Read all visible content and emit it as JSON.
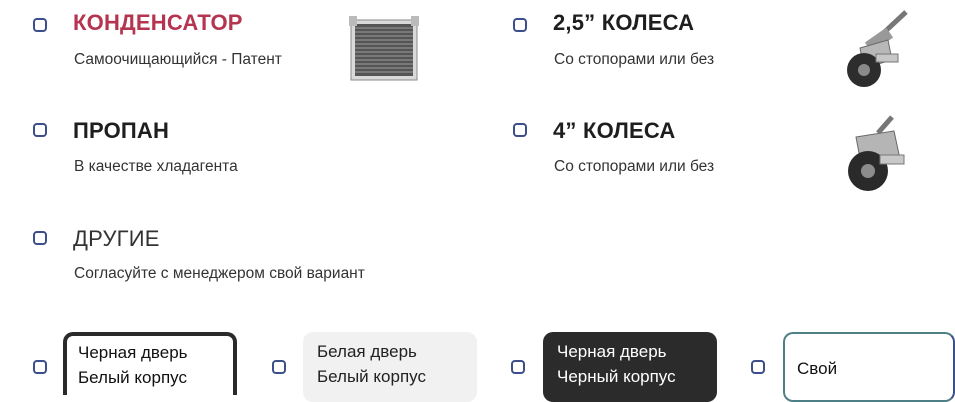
{
  "options": [
    {
      "title": "КОНДЕНСАТОР",
      "subtitle": "Самоочищающийся - Патент",
      "image": "condenser-image"
    },
    {
      "title": "2,5” КОЛЕСА",
      "subtitle": "Со стопорами или без",
      "image": "caster-wheel-image"
    },
    {
      "title": "ПРОПАН",
      "subtitle": "В качестве хладагента"
    },
    {
      "title": "4” КОЛЕСА",
      "subtitle": "Со стопорами или без",
      "image": "caster-wheel-image"
    },
    {
      "title": "ДРУГИЕ",
      "subtitle": "Согласуйте с менеджером свой вариант"
    }
  ],
  "colors": [
    {
      "line1": "Черная дверь",
      "line2": "Белый корпус"
    },
    {
      "line1": "Белая дверь",
      "line2": "Белый корпус"
    },
    {
      "line1": "Черная дверь",
      "line2": "Черный корпус"
    },
    {
      "line1": "Свой"
    }
  ],
  "theme": {
    "accent": "#b5344f",
    "checkbox_border": "#3d4f8a"
  }
}
